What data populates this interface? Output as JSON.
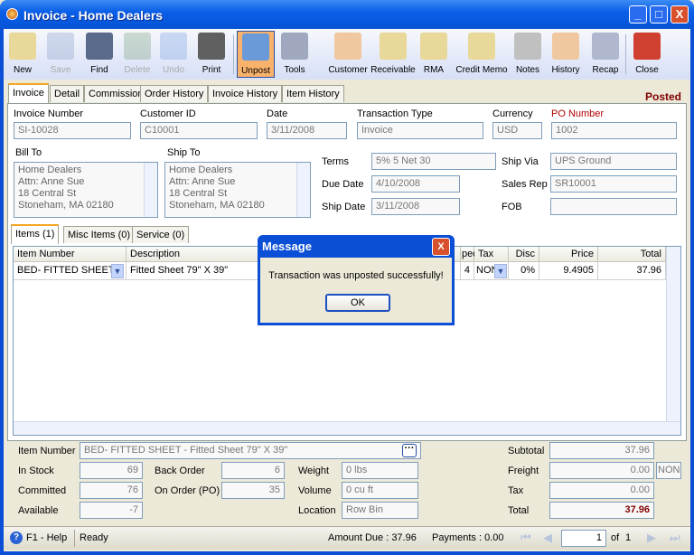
{
  "window": {
    "title": "Invoice - Home Dealers",
    "minimize": "_",
    "maximize": "□",
    "close": "X"
  },
  "toolbar": [
    {
      "label": "New",
      "icon": "new-icon",
      "enabled": true
    },
    {
      "label": "Save",
      "icon": "save-icon",
      "enabled": false
    },
    {
      "label": "Find",
      "icon": "find-icon",
      "enabled": true
    },
    {
      "label": "Delete",
      "icon": "delete-icon",
      "enabled": false
    },
    {
      "label": "Undo",
      "icon": "undo-icon",
      "enabled": false
    },
    {
      "label": "Print",
      "icon": "print-icon",
      "enabled": true
    },
    {
      "label": "Unpost",
      "icon": "unpost-icon",
      "enabled": true,
      "active": true
    },
    {
      "label": "Tools",
      "icon": "tools-icon",
      "enabled": true
    },
    {
      "label": "Customer",
      "icon": "customer-icon",
      "enabled": true
    },
    {
      "label": "Receivable",
      "icon": "receivable-icon",
      "enabled": true
    },
    {
      "label": "RMA",
      "icon": "rma-icon",
      "enabled": true
    },
    {
      "label": "Credit Memo",
      "icon": "credit-memo-icon",
      "enabled": true
    },
    {
      "label": "Notes",
      "icon": "notes-icon",
      "enabled": true
    },
    {
      "label": "History",
      "icon": "history-icon",
      "enabled": true
    },
    {
      "label": "Recap",
      "icon": "recap-icon",
      "enabled": true
    },
    {
      "label": "Close",
      "icon": "close-icon",
      "enabled": true
    }
  ],
  "tabs": [
    "Invoice",
    "Detail",
    "Commission",
    "Order History",
    "Invoice History",
    "Item History"
  ],
  "status_label": "Posted",
  "header": {
    "invoice_number": {
      "label": "Invoice Number",
      "value": "SI-10028"
    },
    "customer_id": {
      "label": "Customer ID",
      "value": "C10001"
    },
    "date": {
      "label": "Date",
      "value": "3/11/2008"
    },
    "transaction_type": {
      "label": "Transaction Type",
      "value": "Invoice"
    },
    "currency": {
      "label": "Currency",
      "value": "USD"
    },
    "po_number": {
      "label": "PO Number",
      "value": "1002"
    }
  },
  "bill_to": {
    "label": "Bill To",
    "lines": [
      "Home Dealers",
      "Attn: Anne Sue",
      "18 Central St",
      "Stoneham, MA 02180"
    ]
  },
  "ship_to": {
    "label": "Ship To",
    "lines": [
      "Home Dealers",
      "Attn: Anne Sue",
      "18 Central St",
      "Stoneham, MA 02180"
    ]
  },
  "terms": {
    "label": "Terms",
    "value": "5% 5 Net 30"
  },
  "due_date": {
    "label": "Due Date",
    "value": "4/10/2008"
  },
  "ship_date": {
    "label": "Ship Date",
    "value": "3/11/2008"
  },
  "ship_via": {
    "label": "Ship Via",
    "value": "UPS Ground"
  },
  "sales_rep": {
    "label": "Sales Rep",
    "value": "SR10001"
  },
  "fob": {
    "label": "FOB",
    "value": ""
  },
  "item_tabs": [
    "Items (1)",
    "Misc Items (0)",
    "Service (0)"
  ],
  "grid": {
    "columns": [
      "Item Number",
      "Description",
      "ped",
      "Tax",
      "Disc",
      "Price",
      "Total"
    ],
    "rows": [
      {
        "item": "BED- FITTED SHEET",
        "description": "Fitted Sheet 79\" X 39\"",
        "shipped": "4",
        "tax": "NON",
        "disc": "0%",
        "price": "9.4905",
        "total": "37.96"
      }
    ]
  },
  "dialog": {
    "title": "Message",
    "message": "Transaction was unposted successfully!",
    "ok": "OK"
  },
  "details": {
    "item_number": {
      "label": "Item Number",
      "value": "BED- FITTED SHEET - Fitted Sheet 79\" X 39\""
    },
    "in_stock": {
      "label": "In Stock",
      "value": "69"
    },
    "committed": {
      "label": "Committed",
      "value": "76"
    },
    "available": {
      "label": "Available",
      "value": "-7"
    },
    "back_order": {
      "label": "Back Order",
      "value": "6"
    },
    "on_order": {
      "label": "On Order (PO)",
      "value": "35"
    },
    "weight": {
      "label": "Weight",
      "value": "0 lbs"
    },
    "volume": {
      "label": "Volume",
      "value": "0 cu ft"
    },
    "location": {
      "label": "Location",
      "value": "Row  Bin"
    }
  },
  "totals": {
    "subtotal": {
      "label": "Subtotal",
      "value": "37.96"
    },
    "freight": {
      "label": "Freight",
      "value": "0.00",
      "code": "NON"
    },
    "tax": {
      "label": "Tax",
      "value": "0.00"
    },
    "total": {
      "label": "Total",
      "value": "37.96"
    }
  },
  "statusbar": {
    "help": "F1 - Help",
    "state": "Ready",
    "amount_due": "Amount Due : 37.96",
    "payments": "Payments : 0.00",
    "page": "1",
    "of": "of",
    "total_pages": "1"
  },
  "colors": {
    "accent": "#0a4fd6",
    "posted": "#800000",
    "total": "#800000"
  }
}
